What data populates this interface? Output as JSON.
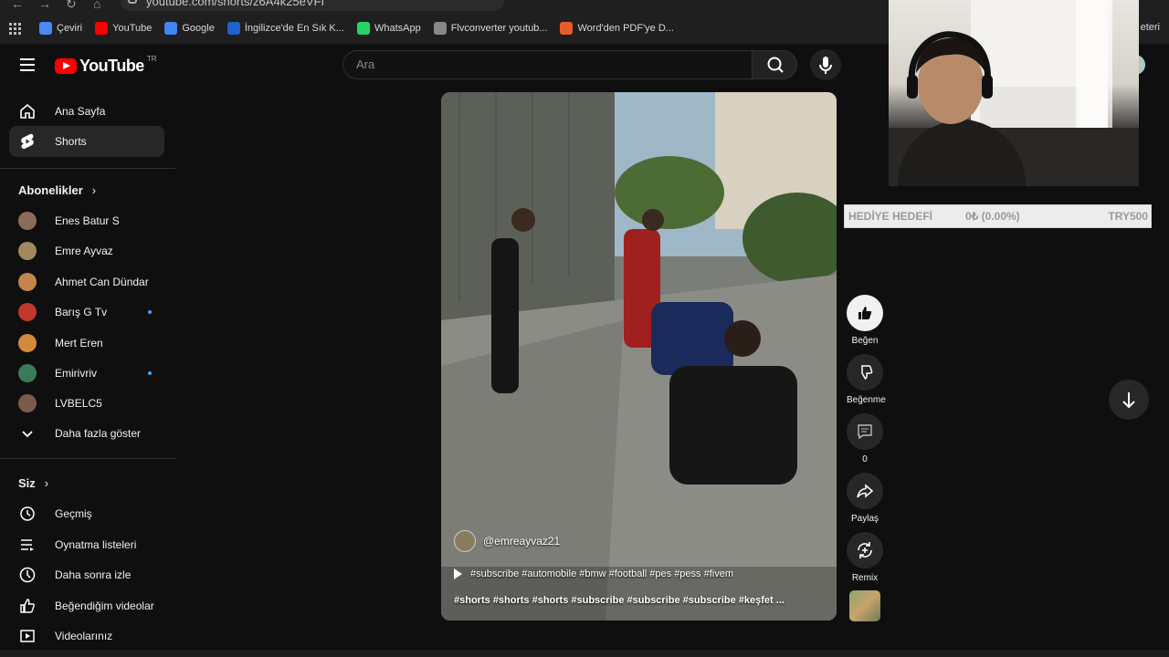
{
  "browser": {
    "url": "youtube.com/shorts/z6A4k25eVFI",
    "bookmarks": [
      {
        "label": "Çeviri",
        "color": "#4a8af4"
      },
      {
        "label": "YouTube",
        "color": "#ff0000"
      },
      {
        "label": "Google",
        "color": "#4285f4"
      },
      {
        "label": "İngilizce'de En Sık K...",
        "color": "#1e62d0"
      },
      {
        "label": "WhatsApp",
        "color": "#25d366"
      },
      {
        "label": "Flvconverter youtub...",
        "color": "#888888"
      },
      {
        "label": "Word'den PDF'ye D...",
        "color": "#e35d2a"
      }
    ],
    "bookmarks_right": "eteri"
  },
  "header": {
    "logo_text": "YouTube",
    "logo_region": "TR",
    "search_placeholder": "Ara"
  },
  "sidebar": {
    "main": [
      {
        "label": "Ana Sayfa",
        "icon": "home-icon"
      },
      {
        "label": "Shorts",
        "icon": "shorts-icon",
        "active": true
      }
    ],
    "subscriptions_title": "Abonelikler",
    "subscriptions": [
      {
        "label": "Enes Batur S",
        "color": "#8b6b5a",
        "dot": false
      },
      {
        "label": "Emre Ayvaz",
        "color": "#a08a5c",
        "dot": false
      },
      {
        "label": "Ahmet Can Dündar",
        "color": "#c4854a",
        "dot": false
      },
      {
        "label": "Barış G Tv",
        "color": "#c0392b",
        "dot": true
      },
      {
        "label": "Mert Eren",
        "color": "#d28a3a",
        "dot": false
      },
      {
        "label": "Emirivriv",
        "color": "#3a7a5a",
        "dot": true
      },
      {
        "label": "LVBELC5",
        "color": "#7a5a4a",
        "dot": false
      }
    ],
    "show_more": "Daha fazla göster",
    "you_title": "Siz",
    "you": [
      {
        "label": "Geçmiş",
        "icon": "history-icon"
      },
      {
        "label": "Oynatma listeleri",
        "icon": "playlists-icon"
      },
      {
        "label": "Daha sonra izle",
        "icon": "watch-later-icon"
      },
      {
        "label": "Beğendiğim videolar",
        "icon": "liked-videos-icon"
      },
      {
        "label": "Videolarınız",
        "icon": "your-videos-icon"
      }
    ]
  },
  "video": {
    "channel": "@emreayvaz21",
    "caption": "#subscribe #automobile #bmw #football #pes #pess #fivem",
    "tags": "#shorts #shorts #shorts #subscribe #subscribe #subscribe #keşfet ..."
  },
  "actions": {
    "like": "Beğen",
    "dislike": "Beğenme",
    "comments": "0",
    "share": "Paylaş",
    "remix": "Remix"
  },
  "gift_goal": {
    "label": "HEDİYE HEDEFİ",
    "progress": "0₺ (0.00%)",
    "target": "TRY500"
  }
}
